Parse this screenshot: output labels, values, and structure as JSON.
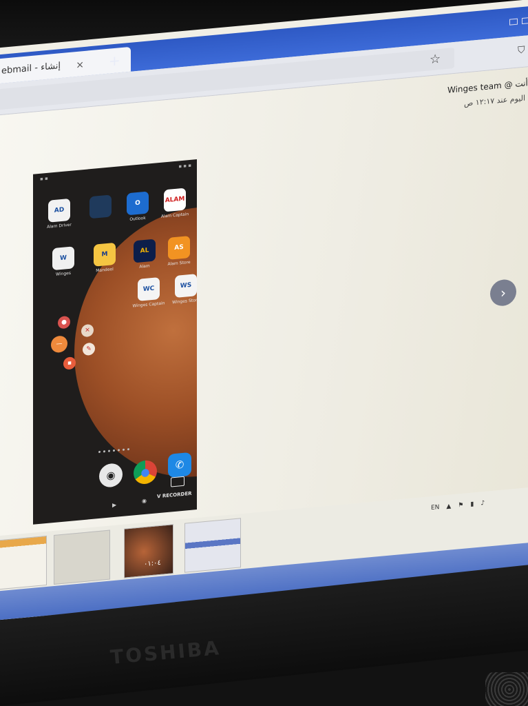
{
  "browser": {
    "tab_title": "ebmail - إنشاء",
    "tab_close": "×",
    "new_tab": "+",
    "bookmark_icon": "star-icon",
    "shield_icon": "shield-icon"
  },
  "email": {
    "sender": "أنت @ Winges team",
    "time": "اليوم عند ١٢:١٧ ص",
    "next_icon": "›"
  },
  "phone": {
    "apps": [
      {
        "label": "Alam Driver",
        "icon": "AD",
        "color": "#f2f2f2",
        "fg": "#1a4fa0"
      },
      {
        "label": "",
        "icon": "",
        "color": "#1f3a5c",
        "fg": "#ffffff"
      },
      {
        "label": "Outlook",
        "icon": "O",
        "color": "#1d6ccf",
        "fg": "#ffffff"
      },
      {
        "label": "Alam Captain",
        "icon": "ALAM",
        "color": "#ffffff",
        "fg": "#d02020"
      },
      {
        "label": "Winges",
        "icon": "W",
        "color": "#f0f0f0",
        "fg": "#1a4fa0"
      },
      {
        "label": "Mandeel",
        "icon": "M",
        "color": "#f5c542",
        "fg": "#1a3c8a"
      },
      {
        "label": "Alam",
        "icon": "AL",
        "color": "#0c1e4a",
        "fg": "#f4b400"
      },
      {
        "label": "Alam Store",
        "icon": "AS",
        "color": "#f29322",
        "fg": "#ffffff"
      },
      {
        "label": "Winges Captain",
        "icon": "WC",
        "color": "#f4f4f4",
        "fg": "#1a4fa0"
      },
      {
        "label": "Winges Store",
        "icon": "WS",
        "color": "#f4f4f4",
        "fg": "#1a4fa0"
      }
    ],
    "dock": [
      "camera-icon",
      "chrome-icon",
      "phone-icon"
    ],
    "recorder_label": "V RECORDER",
    "nav_back": "▶",
    "nav_home": "◉"
  },
  "thumbnails": {
    "video_time": "٠١:٠٤"
  },
  "tray": {
    "lang": "EN"
  },
  "laptop": {
    "brand": "TOSHIBA"
  }
}
